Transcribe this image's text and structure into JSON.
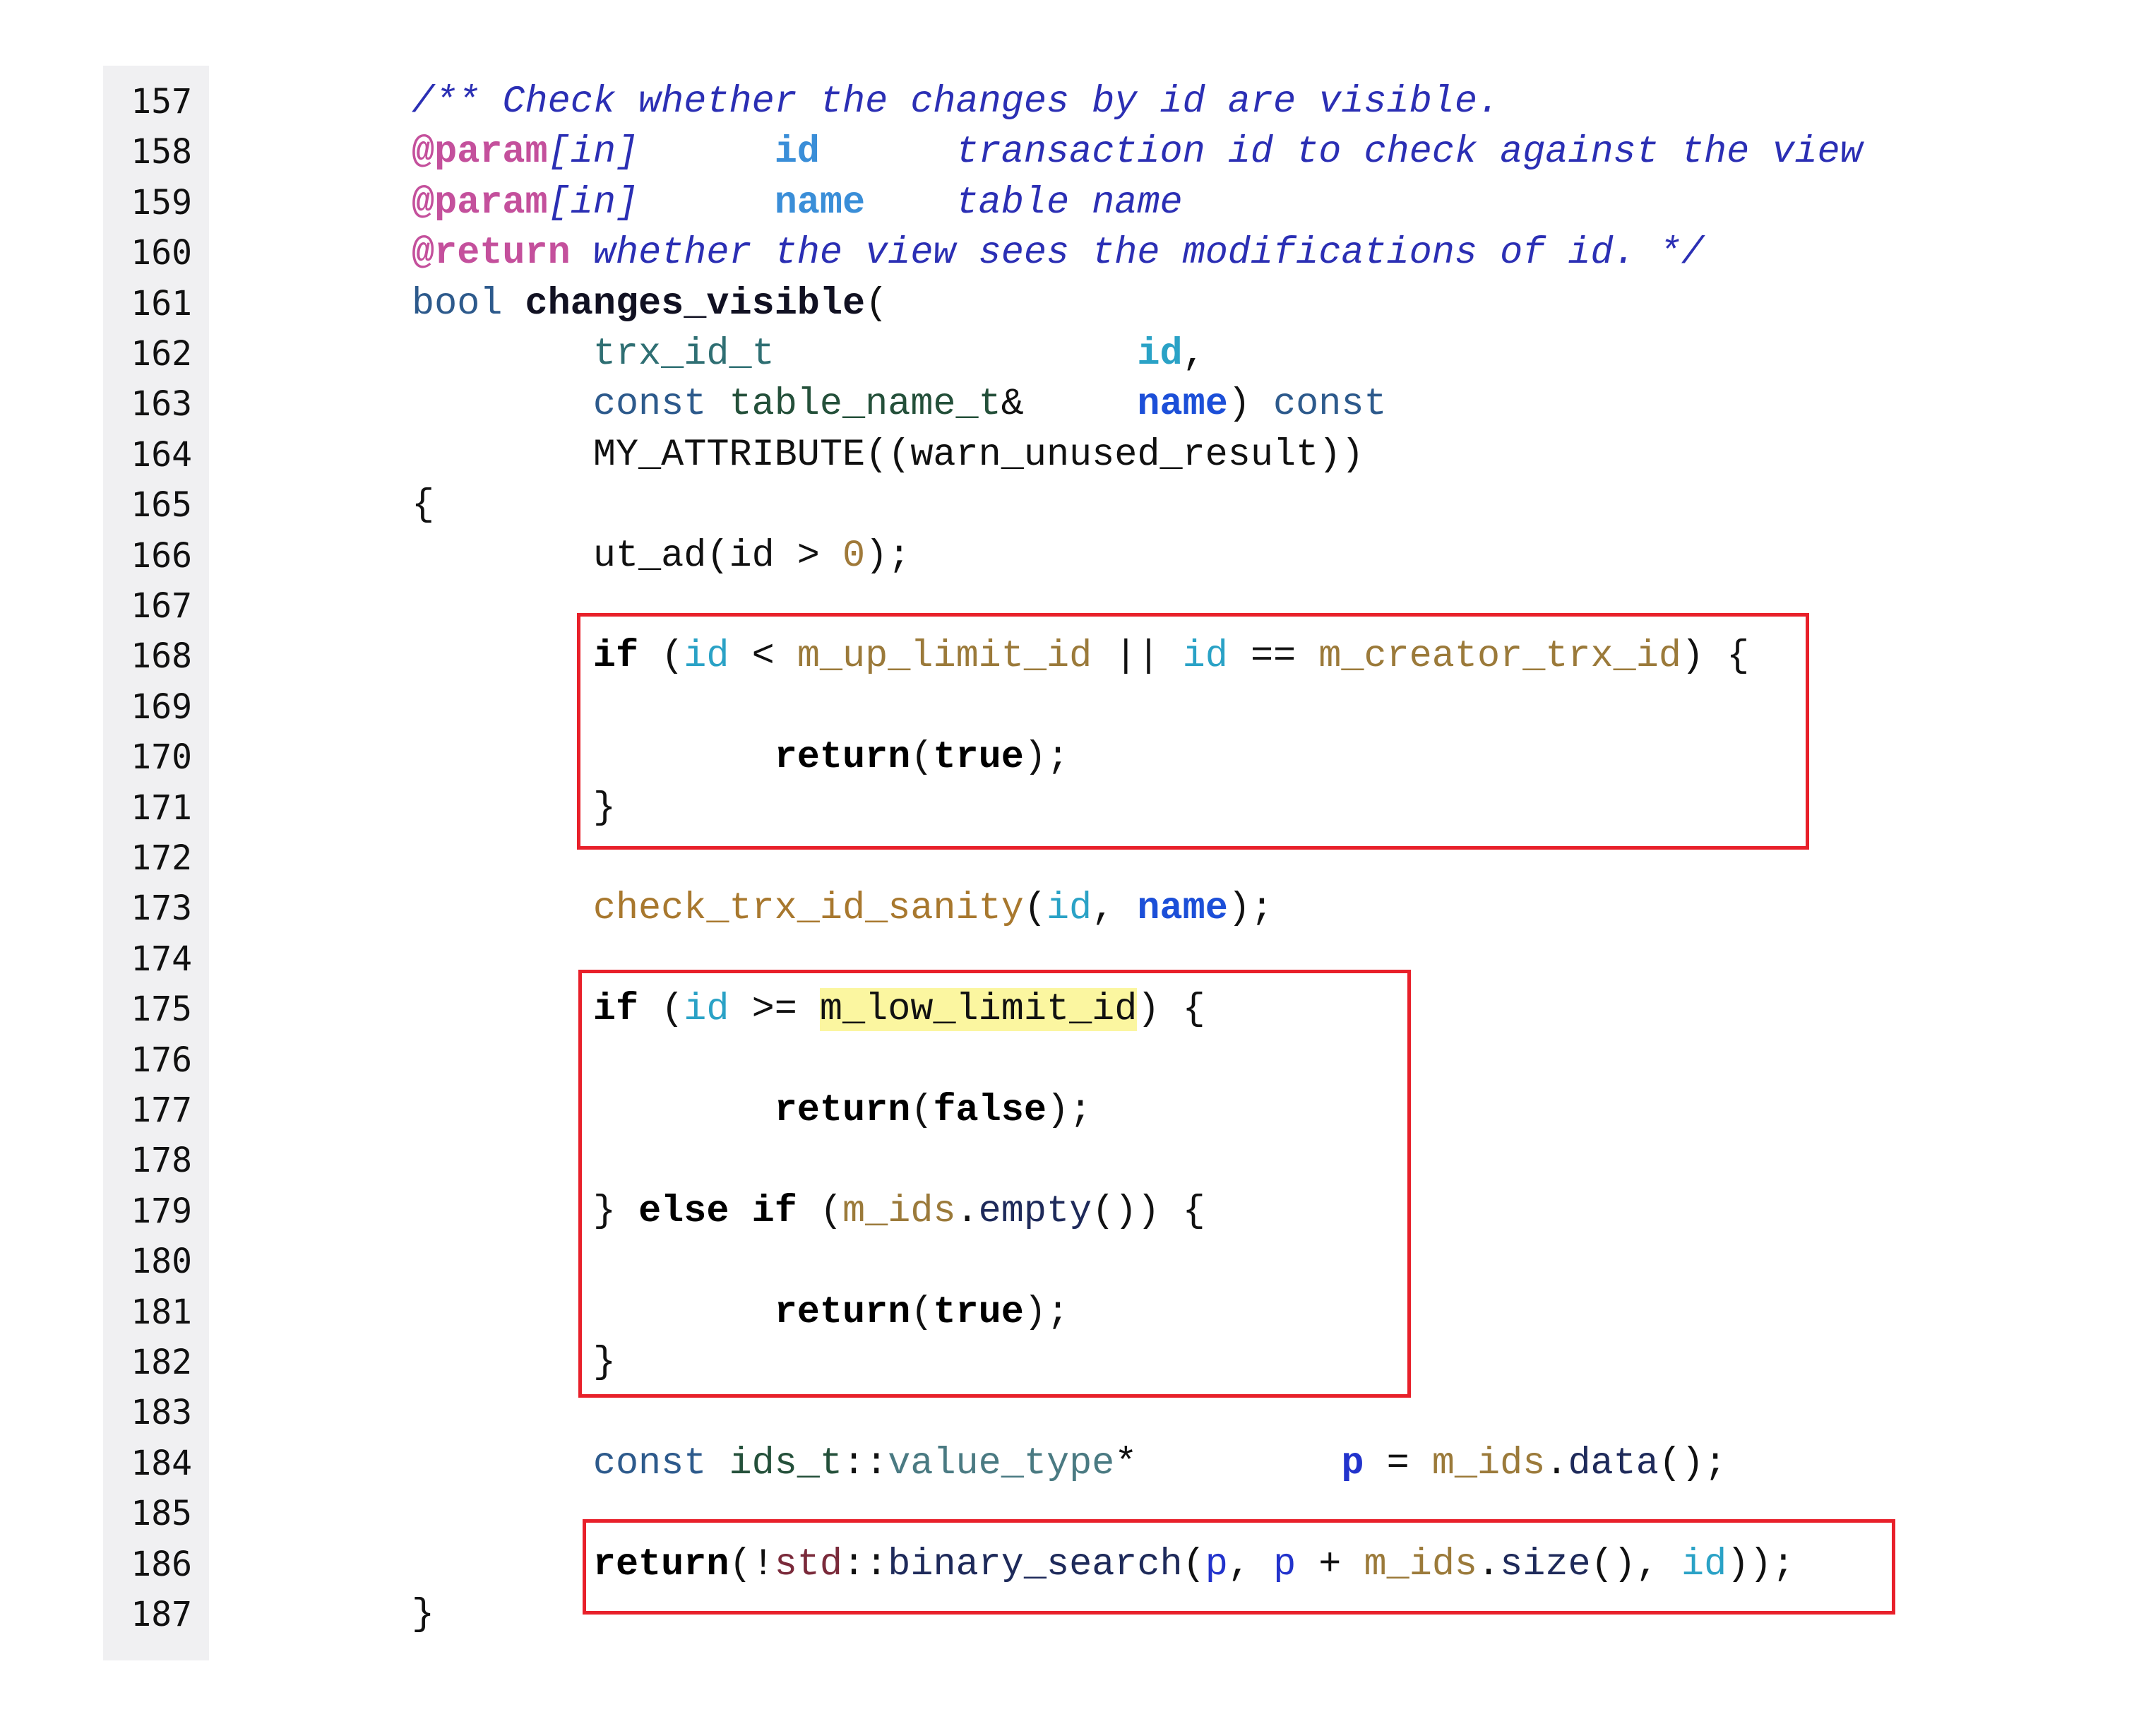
{
  "line_numbers": [
    "157",
    "158",
    "159",
    "160",
    "161",
    "162",
    "163",
    "164",
    "165",
    "166",
    "167",
    "168",
    "169",
    "170",
    "171",
    "172",
    "173",
    "174",
    "175",
    "176",
    "177",
    "178",
    "179",
    "180",
    "181",
    "182",
    "183",
    "184",
    "185",
    "186",
    "187"
  ],
  "code_lines": [
    [
      [
        "/** Check whether the changes by id are visible.",
        "cmt"
      ]
    ],
    [
      [
        "@param",
        "tag"
      ],
      [
        "[in]      ",
        "cmt"
      ],
      [
        "id",
        "pname"
      ],
      [
        "      ",
        "plain"
      ],
      [
        "transaction id to check against the view",
        "cmt"
      ]
    ],
    [
      [
        "@param",
        "tag"
      ],
      [
        "[in]      ",
        "cmt"
      ],
      [
        "name",
        "pname"
      ],
      [
        "    ",
        "plain"
      ],
      [
        "table name",
        "cmt"
      ]
    ],
    [
      [
        "@return",
        "tag"
      ],
      [
        " whether the view sees the modifications of id. */",
        "cmt"
      ]
    ],
    [
      [
        "bool",
        "kw"
      ],
      [
        " ",
        "plain"
      ],
      [
        "changes_visible",
        "fn"
      ],
      [
        "(",
        "plain"
      ]
    ],
    [
      [
        "        ",
        "plain"
      ],
      [
        "trx_id_t",
        "type"
      ],
      [
        "                ",
        "plain"
      ],
      [
        "id",
        "argb"
      ],
      [
        ",",
        "plain"
      ]
    ],
    [
      [
        "        ",
        "plain"
      ],
      [
        "const",
        "kw"
      ],
      [
        " ",
        "plain"
      ],
      [
        "table_name_t",
        "type2"
      ],
      [
        "&",
        "plain"
      ],
      [
        "     ",
        "plain"
      ],
      [
        "name",
        "name"
      ],
      [
        ") ",
        "plain"
      ],
      [
        "const",
        "kw"
      ]
    ],
    [
      [
        "        ",
        "plain"
      ],
      [
        "MY_ATTRIBUTE((warn_unused_result))",
        "plain"
      ]
    ],
    [
      [
        "{",
        "plain"
      ]
    ],
    [
      [
        "        ",
        "plain"
      ],
      [
        "ut_ad(id > ",
        "plain"
      ],
      [
        "0",
        "num"
      ],
      [
        ");",
        "plain"
      ]
    ],
    [],
    [
      [
        "        ",
        "plain"
      ],
      [
        "if",
        "bold"
      ],
      [
        " (",
        "plain"
      ],
      [
        "id",
        "arg"
      ],
      [
        " < ",
        "plain"
      ],
      [
        "m_up_limit_id",
        "mem"
      ],
      [
        " || ",
        "plain"
      ],
      [
        "id",
        "arg"
      ],
      [
        " == ",
        "plain"
      ],
      [
        "m_creator_trx_id",
        "mem"
      ],
      [
        ") {",
        "plain"
      ]
    ],
    [],
    [
      [
        "                ",
        "plain"
      ],
      [
        "return",
        "bold"
      ],
      [
        "(",
        "plain"
      ],
      [
        "true",
        "bold"
      ],
      [
        ");",
        "plain"
      ]
    ],
    [
      [
        "        ",
        "plain"
      ],
      [
        "}",
        "plain"
      ]
    ],
    [],
    [
      [
        "        ",
        "plain"
      ],
      [
        "check_trx_id_sanity",
        "mfn"
      ],
      [
        "(",
        "plain"
      ],
      [
        "id",
        "arg"
      ],
      [
        ", ",
        "plain"
      ],
      [
        "name",
        "name"
      ],
      [
        ");",
        "plain"
      ]
    ],
    [],
    [
      [
        "        ",
        "plain"
      ],
      [
        "if",
        "bold"
      ],
      [
        " (",
        "plain"
      ],
      [
        "id",
        "arg"
      ],
      [
        " >= ",
        "plain"
      ],
      [
        "m_low_limit_id",
        "hl"
      ],
      [
        ") {",
        "plain"
      ]
    ],
    [],
    [
      [
        "                ",
        "plain"
      ],
      [
        "return",
        "bold"
      ],
      [
        "(",
        "plain"
      ],
      [
        "false",
        "bold"
      ],
      [
        ");",
        "plain"
      ]
    ],
    [],
    [
      [
        "        ",
        "plain"
      ],
      [
        "} ",
        "plain"
      ],
      [
        "else if",
        "bold"
      ],
      [
        " (",
        "plain"
      ],
      [
        "m_ids",
        "mem"
      ],
      [
        ".",
        "plain"
      ],
      [
        "empty",
        "method"
      ],
      [
        "()) {",
        "plain"
      ]
    ],
    [],
    [
      [
        "                ",
        "plain"
      ],
      [
        "return",
        "bold"
      ],
      [
        "(",
        "plain"
      ],
      [
        "true",
        "bold"
      ],
      [
        ");",
        "plain"
      ]
    ],
    [
      [
        "        ",
        "plain"
      ],
      [
        "}",
        "plain"
      ]
    ],
    [],
    [
      [
        "        ",
        "plain"
      ],
      [
        "const",
        "kw"
      ],
      [
        " ",
        "plain"
      ],
      [
        "ids_t",
        "type2"
      ],
      [
        "::",
        "plain"
      ],
      [
        "value_type",
        "type3"
      ],
      [
        "*",
        "plain"
      ],
      [
        "         ",
        "plain"
      ],
      [
        "p",
        "ptrb"
      ],
      [
        " = ",
        "plain"
      ],
      [
        "m_ids",
        "mem"
      ],
      [
        ".",
        "plain"
      ],
      [
        "data",
        "method"
      ],
      [
        "();",
        "plain"
      ]
    ],
    [],
    [
      [
        "        ",
        "plain"
      ],
      [
        "return",
        "bold"
      ],
      [
        "(!",
        "plain"
      ],
      [
        "std",
        "ns"
      ],
      [
        "::",
        "plain"
      ],
      [
        "binary_search",
        "method"
      ],
      [
        "(",
        "plain"
      ],
      [
        "p",
        "ptr"
      ],
      [
        ", ",
        "plain"
      ],
      [
        "p",
        "ptr"
      ],
      [
        " + ",
        "plain"
      ],
      [
        "m_ids",
        "mem"
      ],
      [
        ".",
        "plain"
      ],
      [
        "size",
        "method"
      ],
      [
        "(), ",
        "plain"
      ],
      [
        "id",
        "arg"
      ],
      [
        "));",
        "plain"
      ]
    ],
    [
      [
        "}",
        "plain"
      ]
    ]
  ],
  "highlight_boxes": [
    {
      "label": "fast-path-visible-check",
      "from_line": "168",
      "to_line": "171"
    },
    {
      "label": "low-limit-and-empty-check",
      "from_line": "175",
      "to_line": "182"
    },
    {
      "label": "binary-search-return",
      "from_line": "186",
      "to_line": "186"
    }
  ],
  "colors": {
    "box_border": "#e8202a",
    "highlight": "#fbf6a0",
    "gutter_bg": "#f0f0f2"
  }
}
